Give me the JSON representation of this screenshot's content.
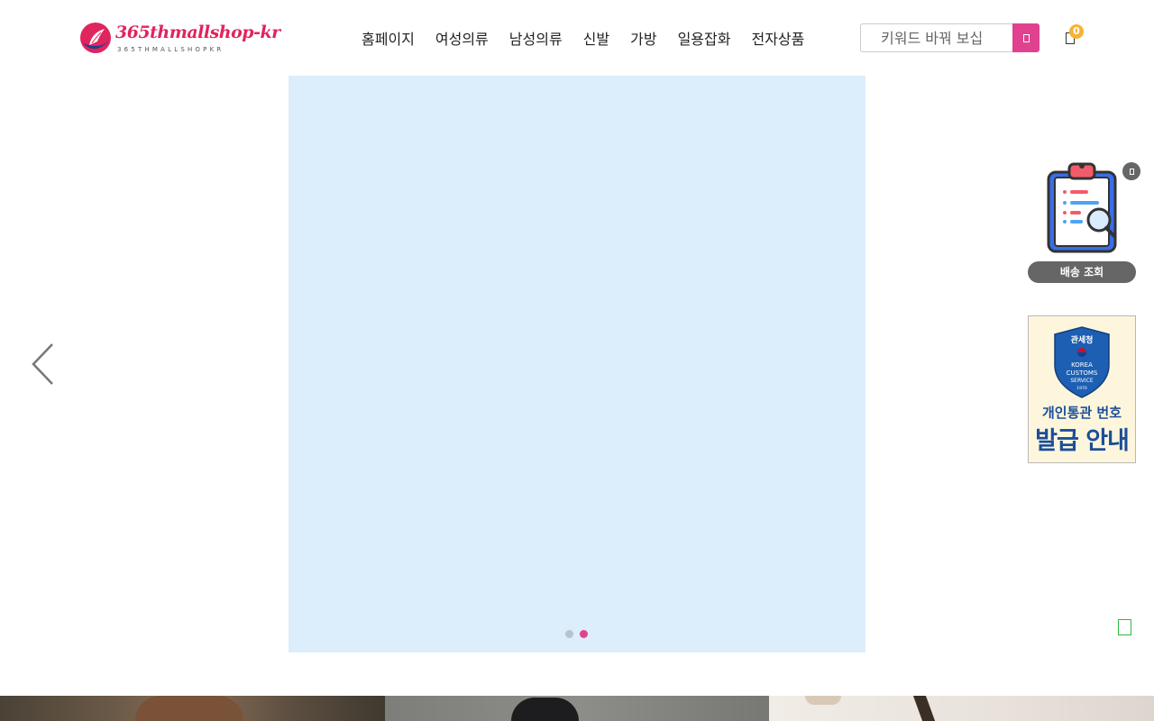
{
  "header": {
    "logo_text": "365thmallshop-kr",
    "logo_sub": "365THMALLSHOPKR",
    "nav": [
      {
        "label": "홈페이지"
      },
      {
        "label": "여성의류"
      },
      {
        "label": "남성의류"
      },
      {
        "label": "신발"
      },
      {
        "label": "가방"
      },
      {
        "label": "일용잡화"
      },
      {
        "label": "전자상품"
      }
    ],
    "search_placeholder": "키워드 바꿔 보십",
    "cart_count": "0"
  },
  "slider": {
    "background": "#dcedfc",
    "dots_total": 2,
    "active_dot": 2
  },
  "float": {
    "delivery_label": "배송 조회",
    "customs_agency": "관세청",
    "customs_seal_lines": [
      "KOREA",
      "CUSTOMS",
      "SERVICE"
    ],
    "customs_seal_year": "1970",
    "customs_line1": "개인통관 번호",
    "customs_line2": "발급 안내"
  },
  "colors": {
    "accent": "#e0428f",
    "badge": "#f5b332",
    "customs_blue": "#1c4e99",
    "green": "#2dbb3f"
  },
  "icons": [
    "shopping-bag-icon",
    "search-icon",
    "chevron-left-icon",
    "clipboard-search-icon",
    "close-icon",
    "customs-shield-icon",
    "chat-icon"
  ]
}
